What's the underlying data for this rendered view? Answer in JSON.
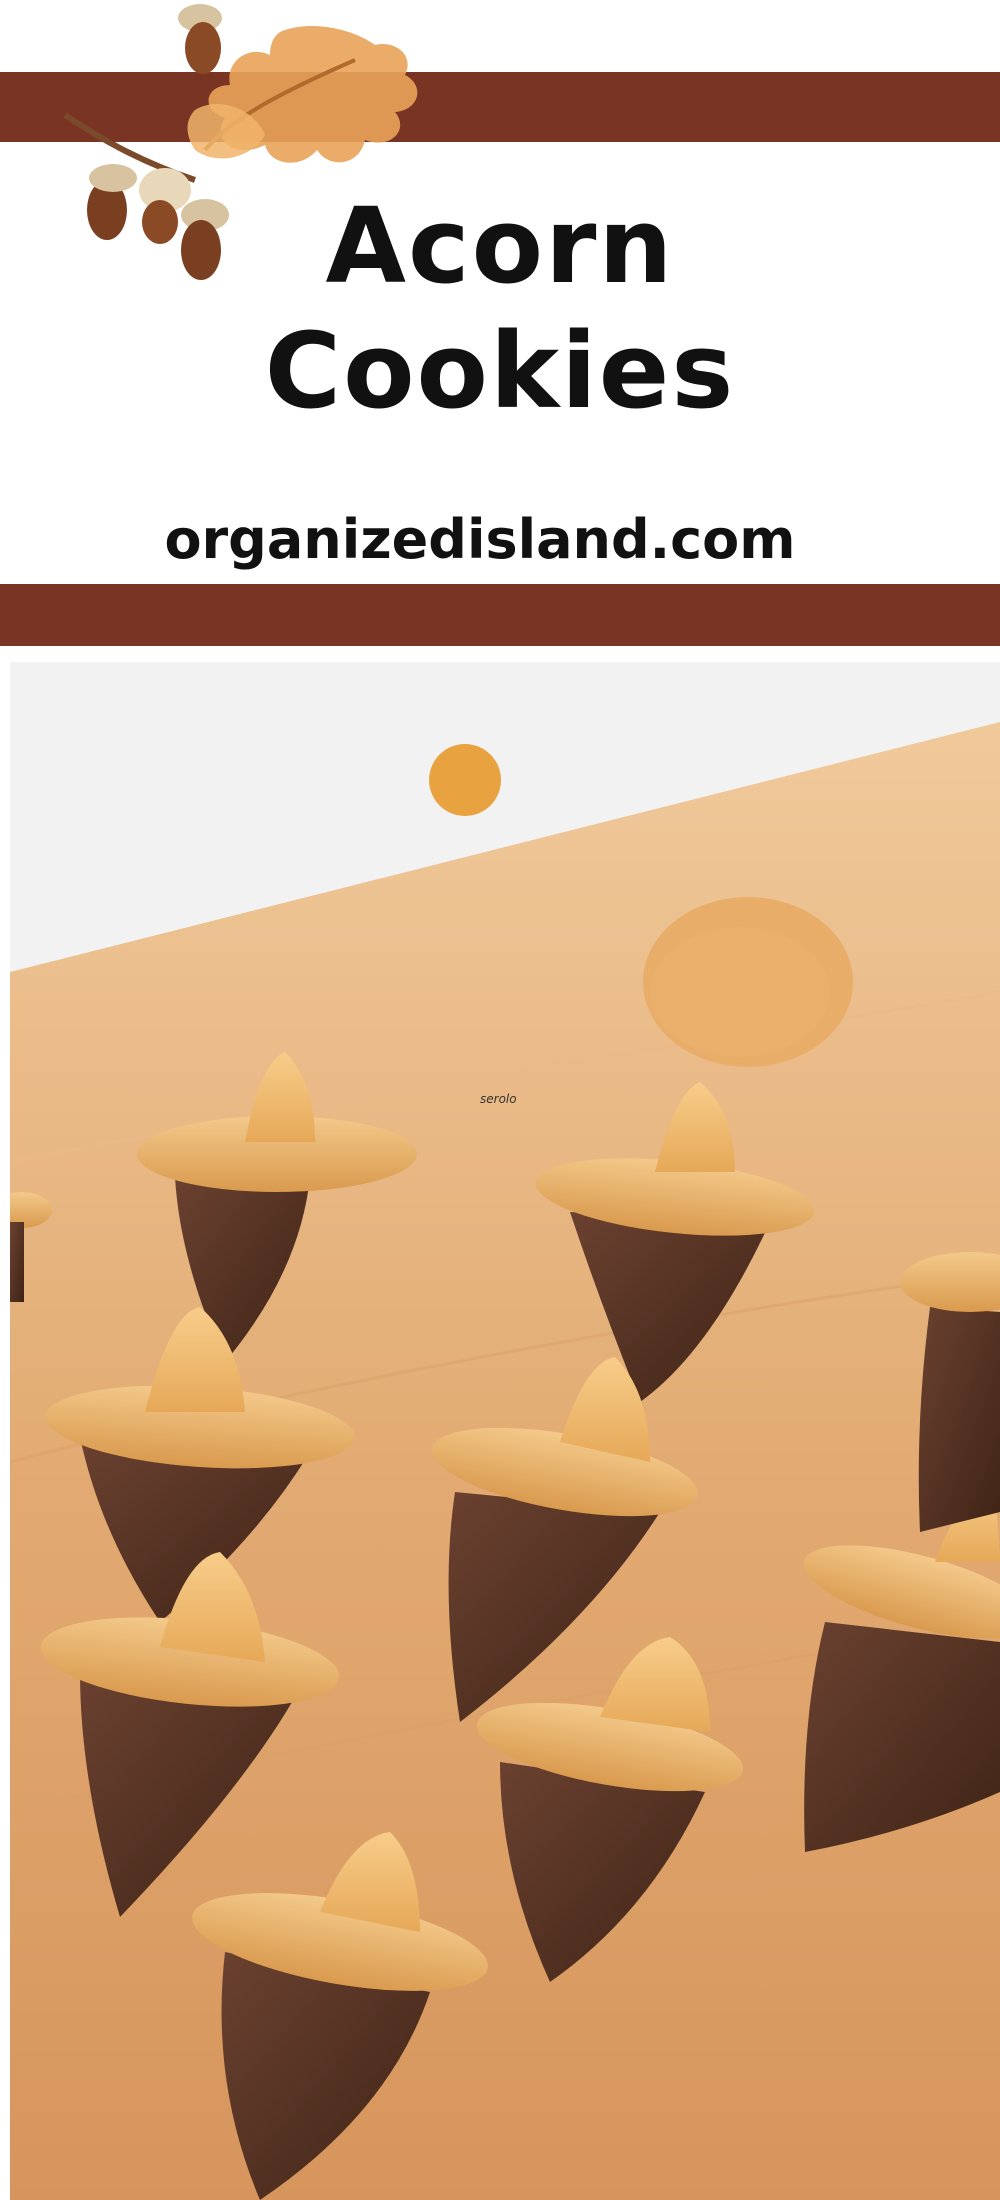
{
  "header": {
    "title_line1": "Acorn",
    "title_line2": "Cookies",
    "website": "organizedisland.com"
  },
  "photo": {
    "watermark": "serolo"
  },
  "colors": {
    "band": "#7a3424",
    "board": "#e2ab73",
    "chocolate": "#5a3522",
    "cookie": "#e6b26c",
    "butterscotch": "#f0b45a"
  },
  "icons": [
    "oak-leaf-icon",
    "acorn-icon"
  ]
}
